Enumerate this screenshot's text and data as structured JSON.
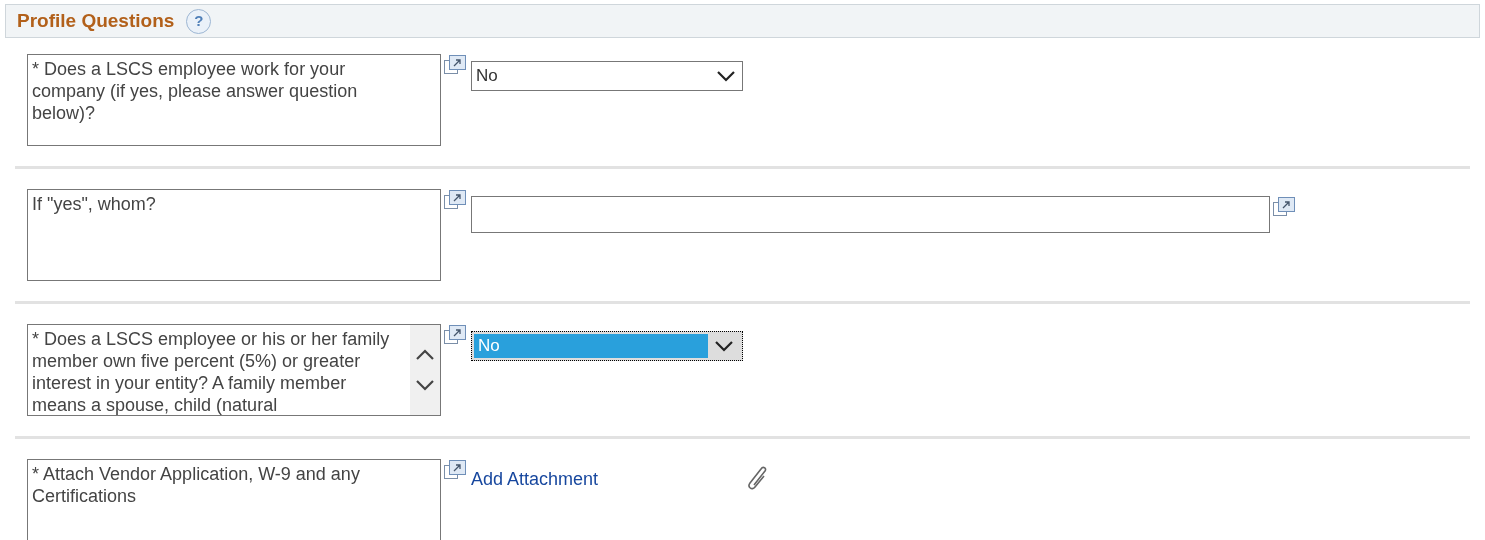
{
  "section": {
    "title": "Profile Questions",
    "help": "?"
  },
  "questions": [
    {
      "kind": "select",
      "prompt": "* Does a LSCS employee work for your company (if yes, please answer question below)?",
      "scrollable": false,
      "value": "No",
      "focused": false
    },
    {
      "kind": "text",
      "prompt": "If \"yes\", whom?",
      "scrollable": false
    },
    {
      "kind": "select",
      "prompt": "* Does a LSCS employee or his or her family member own five percent (5%) or greater interest in your entity? A family member means a spouse, child (natural",
      "scrollable": true,
      "value": "No",
      "focused": true
    },
    {
      "kind": "attachment",
      "prompt": "* Attach Vendor Application, W-9 and any Certifications",
      "scrollable": false,
      "link": "Add Attachment"
    }
  ]
}
